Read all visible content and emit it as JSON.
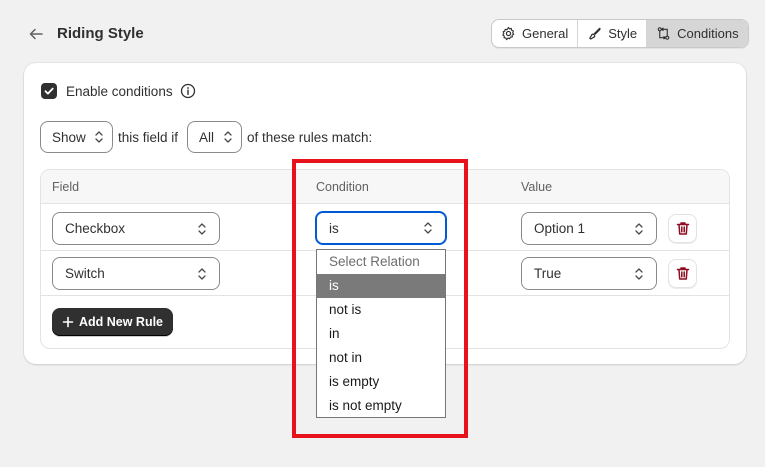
{
  "header": {
    "title": "Riding Style",
    "tabs": [
      {
        "label": "General",
        "icon": "gear-icon"
      },
      {
        "label": "Style",
        "icon": "brush-icon"
      },
      {
        "label": "Conditions",
        "icon": "conditions-icon",
        "active": true
      }
    ]
  },
  "conditions": {
    "enable_label": "Enable conditions",
    "enabled": true,
    "show_value": "Show",
    "text_1": "this field if",
    "match_value": "All",
    "text_2": "of these rules match:"
  },
  "rules": {
    "headers": [
      "Field",
      "Condition",
      "Value"
    ],
    "rows": [
      {
        "field": "Checkbox",
        "condition": "is",
        "value": "Option 1"
      },
      {
        "field": "Switch",
        "condition": "",
        "value": "True"
      }
    ],
    "add_label": "Add New Rule"
  },
  "dropdown": {
    "options": [
      "Select Relation",
      "is",
      "not is",
      "in",
      "not in",
      "is empty",
      "is not empty"
    ],
    "selected": "is"
  },
  "colors": {
    "accent_focus": "#005bd3",
    "highlight": "#e8121d",
    "delete": "#8e0b21"
  }
}
